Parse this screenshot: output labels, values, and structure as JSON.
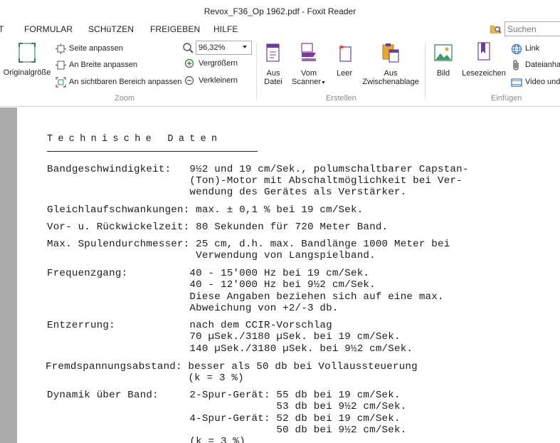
{
  "window": {
    "title": "Revox_F36_Op 1962.pdf - Foxit Reader"
  },
  "menu": {
    "items": [
      {
        "id": "t",
        "label": "T"
      },
      {
        "id": "formular",
        "label": "FORMULAR"
      },
      {
        "id": "schuetzen",
        "label": "SCHüTZEN"
      },
      {
        "id": "freigeben",
        "label": "FREIGEBEN"
      },
      {
        "id": "hilfe",
        "label": "HILFE"
      }
    ]
  },
  "search": {
    "placeholder": "Suchen"
  },
  "ribbon": {
    "zoom_group": {
      "label": "Zoom",
      "originalgroesse": "Originalgröße",
      "seite_anpassen": "Seite anpassen",
      "breite_anpassen": "An Breite anpassen",
      "sichtbar_anpassen": "An sichtbaren Bereich anpassen",
      "zoom_value": "96,32%",
      "vergroessern": "Vergrößern",
      "verkleinern": "Verkleinern"
    },
    "erstellen_group": {
      "label": "Erstellen",
      "aus_datei_1": "Aus",
      "aus_datei_2": "Datei",
      "vom_scanner_1": "Vom",
      "vom_scanner_2": "Scanner",
      "leer": "Leer",
      "aus_zwischenablage_1": "Aus",
      "aus_zwischenablage_2": "Zwischenablage"
    },
    "einfuegen_group": {
      "label": "Einfügen",
      "bild": "Bild",
      "lesezeichen": "Lesezeichen",
      "link": "Link",
      "dateianhang": "Dateianhang",
      "video": "Video und"
    }
  },
  "colors": {
    "scanner_arrow": "#7b3a96",
    "icon_purple": "#6b3f97",
    "icon_orange": "#e8a630",
    "icon_blue": "#2e6fb8",
    "doc_bg": "#ababab"
  },
  "document": {
    "title": "Technische Daten",
    "lines": [
      "Bandgeschwindigkeit:   9½2 und 19 cm/Sek., polumschaltbarer Capstan-",
      "                       (Ton)-Motor mit Abschaltmöglichkeit bei Ver-",
      "                       wendung des Gerätes als Verstärker.",
      "Gleichlaufschwankungen: max. ± 0,1 % bei 19 cm/Sek.",
      "Vor- u. Rückwickelzeit: 80 Sekunden für 720 Meter Band.",
      "Max. Spulendurchmesser: 25 cm, d.h. max. Bandlänge 1000 Meter bei",
      "                        Verwendung von Langspielband.",
      "Frequenzgang:          40 - 15'000 Hz bei 19 cm/Sek.",
      "                       40 - 12'000 Hz bei 9½2 cm/Sek.",
      "                       Diese Angaben beziehen sich auf eine max.",
      "                       Abweichung von +2/-3 db.",
      "Entzerrung:            nach dem CCIR-Vorschlag",
      "                       70 µSek./3180 µSek. bei 19 cm/Sek.",
      "                       140 µSek./3180 µSek. bei 9½2 cm/Sek.",
      "Fremdspannungsabstand: besser als 50 db bei Vollaussteuerung",
      "                       (k = 3 %)",
      "Dynamik über Band:     2-Spur-Gerät: 55 db bei 19 cm/Sek.",
      "                                     53 db bei 9½2 cm/Sek.",
      "                       4-Spur-Gerät: 52 db bei 19 cm/Sek.",
      "                                     50 db bei 9½2 cm/Sek.",
      "                       (k = 3 %)"
    ]
  }
}
